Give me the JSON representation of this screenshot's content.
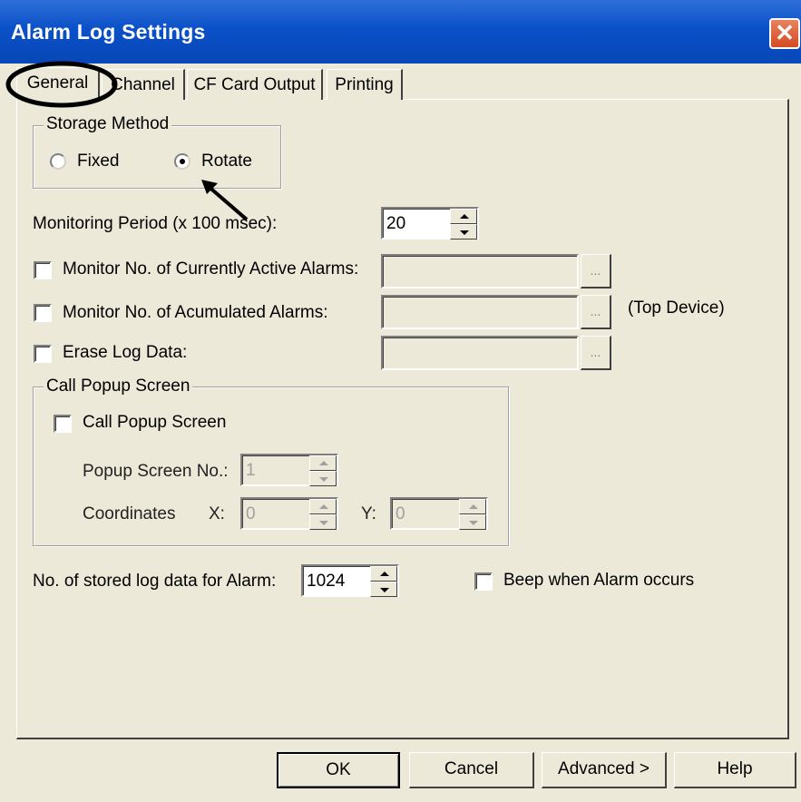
{
  "window": {
    "title": "Alarm Log Settings",
    "close_symbol": "✕"
  },
  "tabs": [
    {
      "label": "General"
    },
    {
      "label": "Channel"
    },
    {
      "label": "CF Card Output"
    },
    {
      "label": "Printing"
    }
  ],
  "storage": {
    "legend": "Storage Method",
    "fixed_label": "Fixed",
    "rotate_label": "Rotate",
    "selected": "Rotate"
  },
  "monitoring": {
    "label": "Monitoring Period (x 100 msec):",
    "value": "20"
  },
  "monitor_active": {
    "label": "Monitor No. of Currently Active Alarms:",
    "browse": "..."
  },
  "monitor_accum": {
    "label": "Monitor No. of Acumulated Alarms:",
    "browse": "...",
    "note": "(Top Device)"
  },
  "erase": {
    "label": "Erase Log Data:",
    "browse": "..."
  },
  "popup": {
    "legend": "Call Popup Screen",
    "checkbox_label": "Call Popup Screen",
    "screen_no_label": "Popup Screen No.:",
    "screen_no_value": "1",
    "coordinates_label": "Coordinates",
    "x_label": "X:",
    "x_value": "0",
    "y_label": "Y:",
    "y_value": "0"
  },
  "stored": {
    "label": "No. of stored log data for Alarm:",
    "value": "1024"
  },
  "beep": {
    "label": "Beep when Alarm occurs"
  },
  "buttons": {
    "ok": "OK",
    "cancel": "Cancel",
    "advanced": "Advanced >",
    "help": "Help"
  }
}
